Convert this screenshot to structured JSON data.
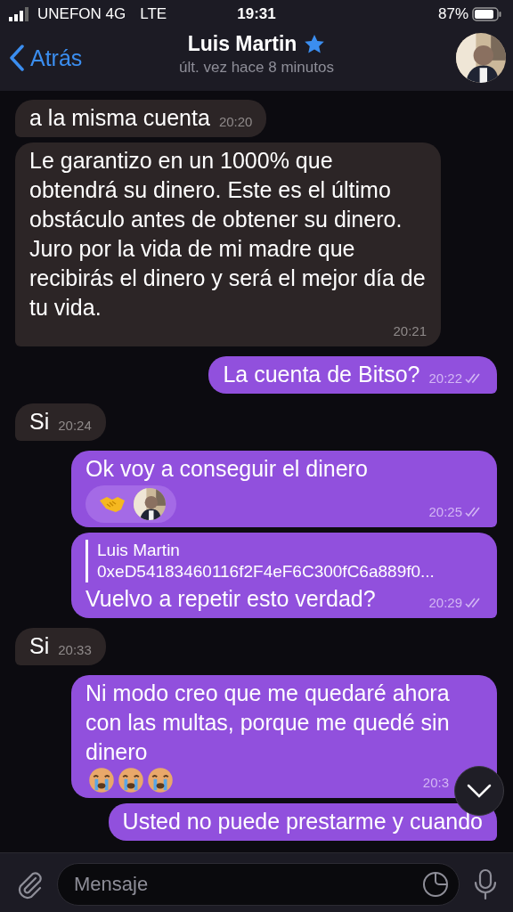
{
  "status_bar": {
    "carrier": "UNEFON 4G",
    "network": "LTE",
    "time": "19:31",
    "battery": "87%"
  },
  "header": {
    "back": "Atrás",
    "name": "Luis Martin",
    "starred": true,
    "last_seen": "últ. vez hace 8 minutos"
  },
  "messages": [
    {
      "kind": "in",
      "text": "a la misma cuenta",
      "time": "20:20"
    },
    {
      "kind": "in",
      "text": "Le garantizo en un 1000% que obtendrá su dinero. Este es el último obstáculo antes de obtener su dinero. Juro por la vida de mi madre que recibirás el dinero y será el mejor día de tu vida.",
      "time": "20:21"
    },
    {
      "kind": "out",
      "text": "La cuenta de Bitso?",
      "time": "20:22",
      "read": true
    },
    {
      "kind": "in",
      "text": "Si",
      "time": "20:24"
    },
    {
      "kind": "out",
      "text": "Ok voy a conseguir el dinero",
      "time": "20:25",
      "read": true,
      "reactions": [
        {
          "kind": "handshake"
        }
      ]
    },
    {
      "kind": "out",
      "reply": {
        "name": "Luis Martin",
        "text": "0xeD54183460116f2F4eF6C300fC6a889f0..."
      },
      "text": "Vuelvo a repetir esto verdad?",
      "time": "20:29",
      "read": true
    },
    {
      "kind": "in",
      "text": "Si",
      "time": "20:33"
    },
    {
      "kind": "out",
      "text": "Ni modo creo que me quedaré ahora con las multas, porque me quedé sin dinero",
      "emojis": [
        {
          "kind": "crying"
        },
        {
          "kind": "crying"
        },
        {
          "kind": "crying"
        }
      ],
      "time": "20:3"
    },
    {
      "kind": "out",
      "text": "Usted no puede prestarme y cuando"
    }
  ],
  "composer": {
    "placeholder": "Mensaje"
  }
}
